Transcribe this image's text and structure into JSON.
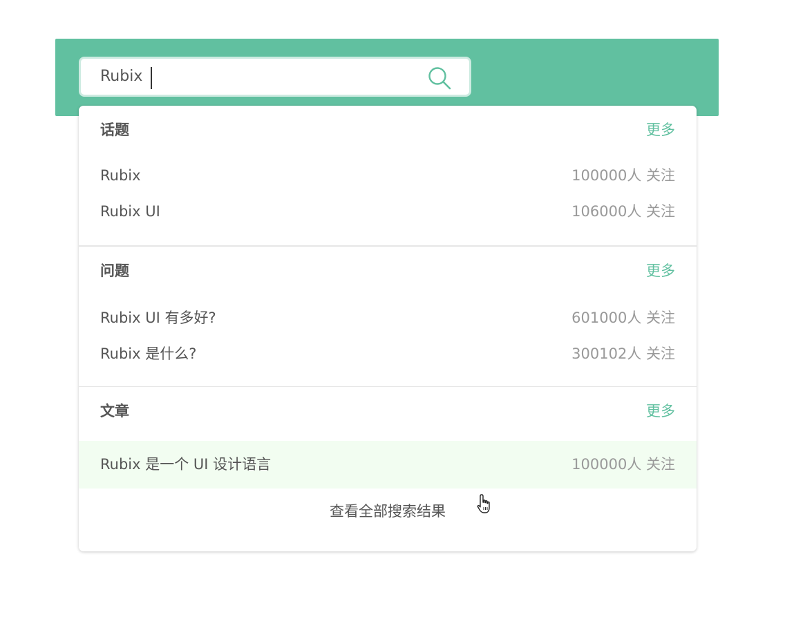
{
  "search": {
    "value": "Rubix"
  },
  "sections": [
    {
      "title": "话题",
      "more_label": "更多",
      "items": [
        {
          "title": "Rubix",
          "count": "100000",
          "suffix": "人 关注"
        },
        {
          "title": "Rubix UI",
          "count": "106000",
          "suffix": "人 关注"
        }
      ]
    },
    {
      "title": "问题",
      "more_label": "更多",
      "items": [
        {
          "title": "Rubix UI 有多好?",
          "count": "601000",
          "suffix": "人 关注"
        },
        {
          "title": "Rubix 是什么?",
          "count": "300102",
          "suffix": "人 关注"
        }
      ]
    },
    {
      "title": "文章",
      "more_label": "更多",
      "items": [
        {
          "title": "Rubix 是一个 UI 设计语言",
          "count": "100000",
          "suffix": "人 关注"
        }
      ]
    }
  ],
  "footer": {
    "view_all_label": "查看全部搜索结果"
  },
  "colors": {
    "header_bg": "#61c0a0",
    "accent": "#61c0a0",
    "hover_row_bg": "#f2fdf1"
  },
  "icons": [
    "search-icon",
    "pointer-hand-icon"
  ]
}
